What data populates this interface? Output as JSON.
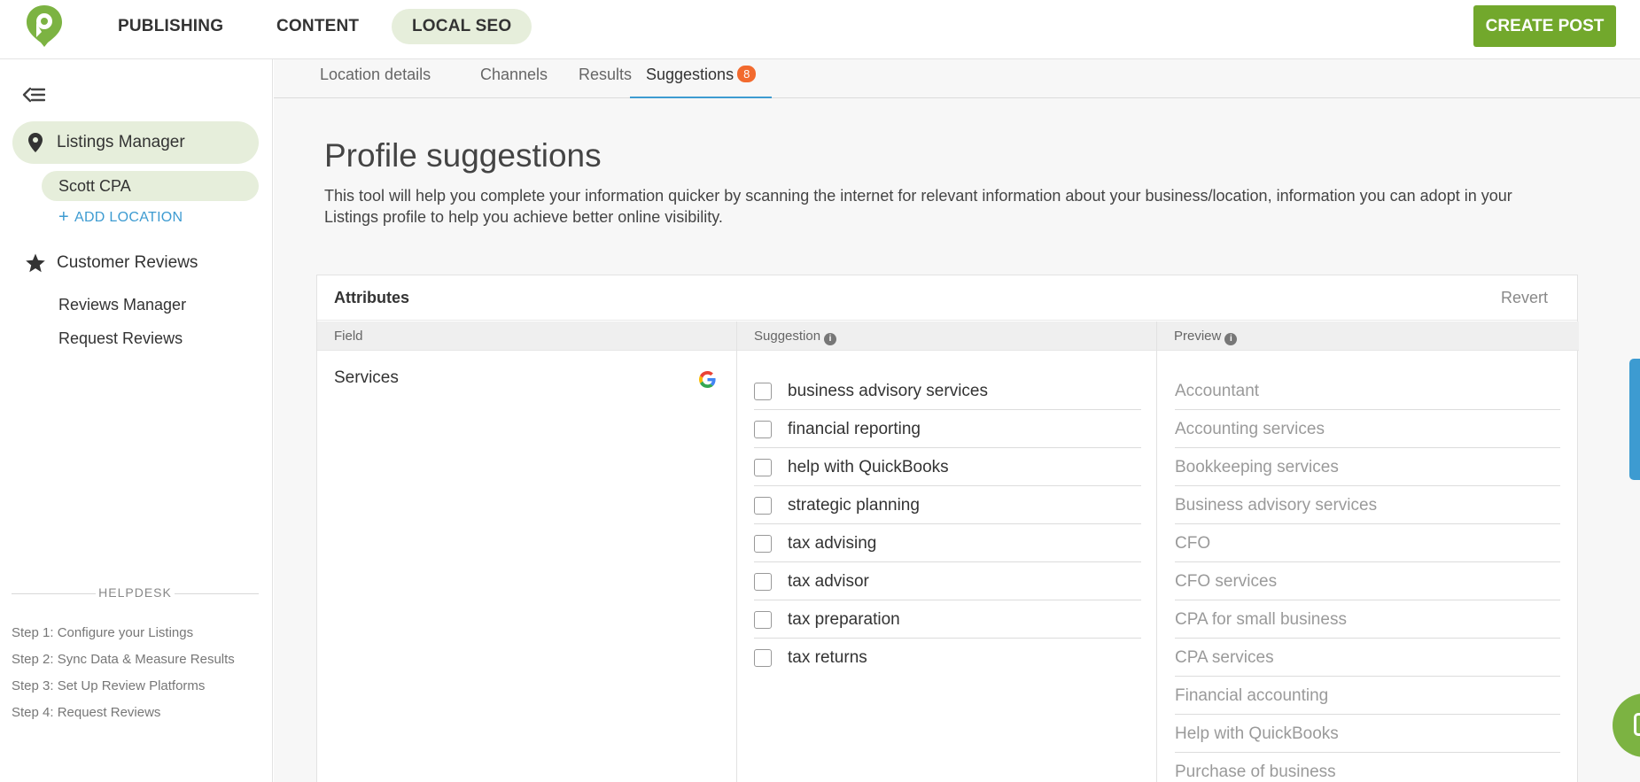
{
  "topnav": {
    "items": [
      {
        "label": "PUBLISHING",
        "active": false
      },
      {
        "label": "CONTENT",
        "active": false
      },
      {
        "label": "LOCAL SEO",
        "active": true
      }
    ],
    "create_post": "CREATE POST",
    "brand_color": "#72a82c",
    "active_pill_color": "#e6eedb"
  },
  "sidebar": {
    "listings_manager": "Listings Manager",
    "location": "Scott CPA",
    "add_location": "ADD LOCATION",
    "customer_reviews": "Customer Reviews",
    "reviews_manager": "Reviews Manager",
    "request_reviews": "Request Reviews",
    "helpdesk": {
      "title": "HELPDESK",
      "steps": [
        "Step 1: Configure your Listings",
        "Step 2: Sync Data & Measure Results",
        "Step 3: Set Up Review Platforms",
        "Step 4: Request Reviews"
      ]
    }
  },
  "tabs": {
    "items": [
      {
        "label": "Location details"
      },
      {
        "label": "Channels"
      },
      {
        "label": "Results"
      },
      {
        "label": "Suggestions",
        "badge": "8",
        "active": true
      }
    ],
    "badge_color": "#f26a2e"
  },
  "page": {
    "title": "Profile suggestions",
    "description": "This tool will help you complete your information quicker by scanning the internet for relevant information about your business/location, information you can adopt in your Listings profile to help you achieve better online visibility."
  },
  "attributes": {
    "title": "Attributes",
    "revert": "Revert",
    "columns": {
      "field": "Field",
      "suggestion": "Suggestion",
      "preview": "Preview"
    },
    "field": "Services",
    "suggestions": [
      "business advisory services",
      "financial reporting",
      "help with QuickBooks",
      "strategic planning",
      "tax advising",
      "tax advisor",
      "tax preparation",
      "tax returns"
    ],
    "preview": [
      "Accountant",
      "Accounting services",
      "Bookkeeping services",
      "Business advisory services",
      "CFO",
      "CFO services",
      "CPA for small business",
      "CPA services",
      "Financial accounting",
      "Help with QuickBooks",
      "Purchase of business"
    ]
  }
}
